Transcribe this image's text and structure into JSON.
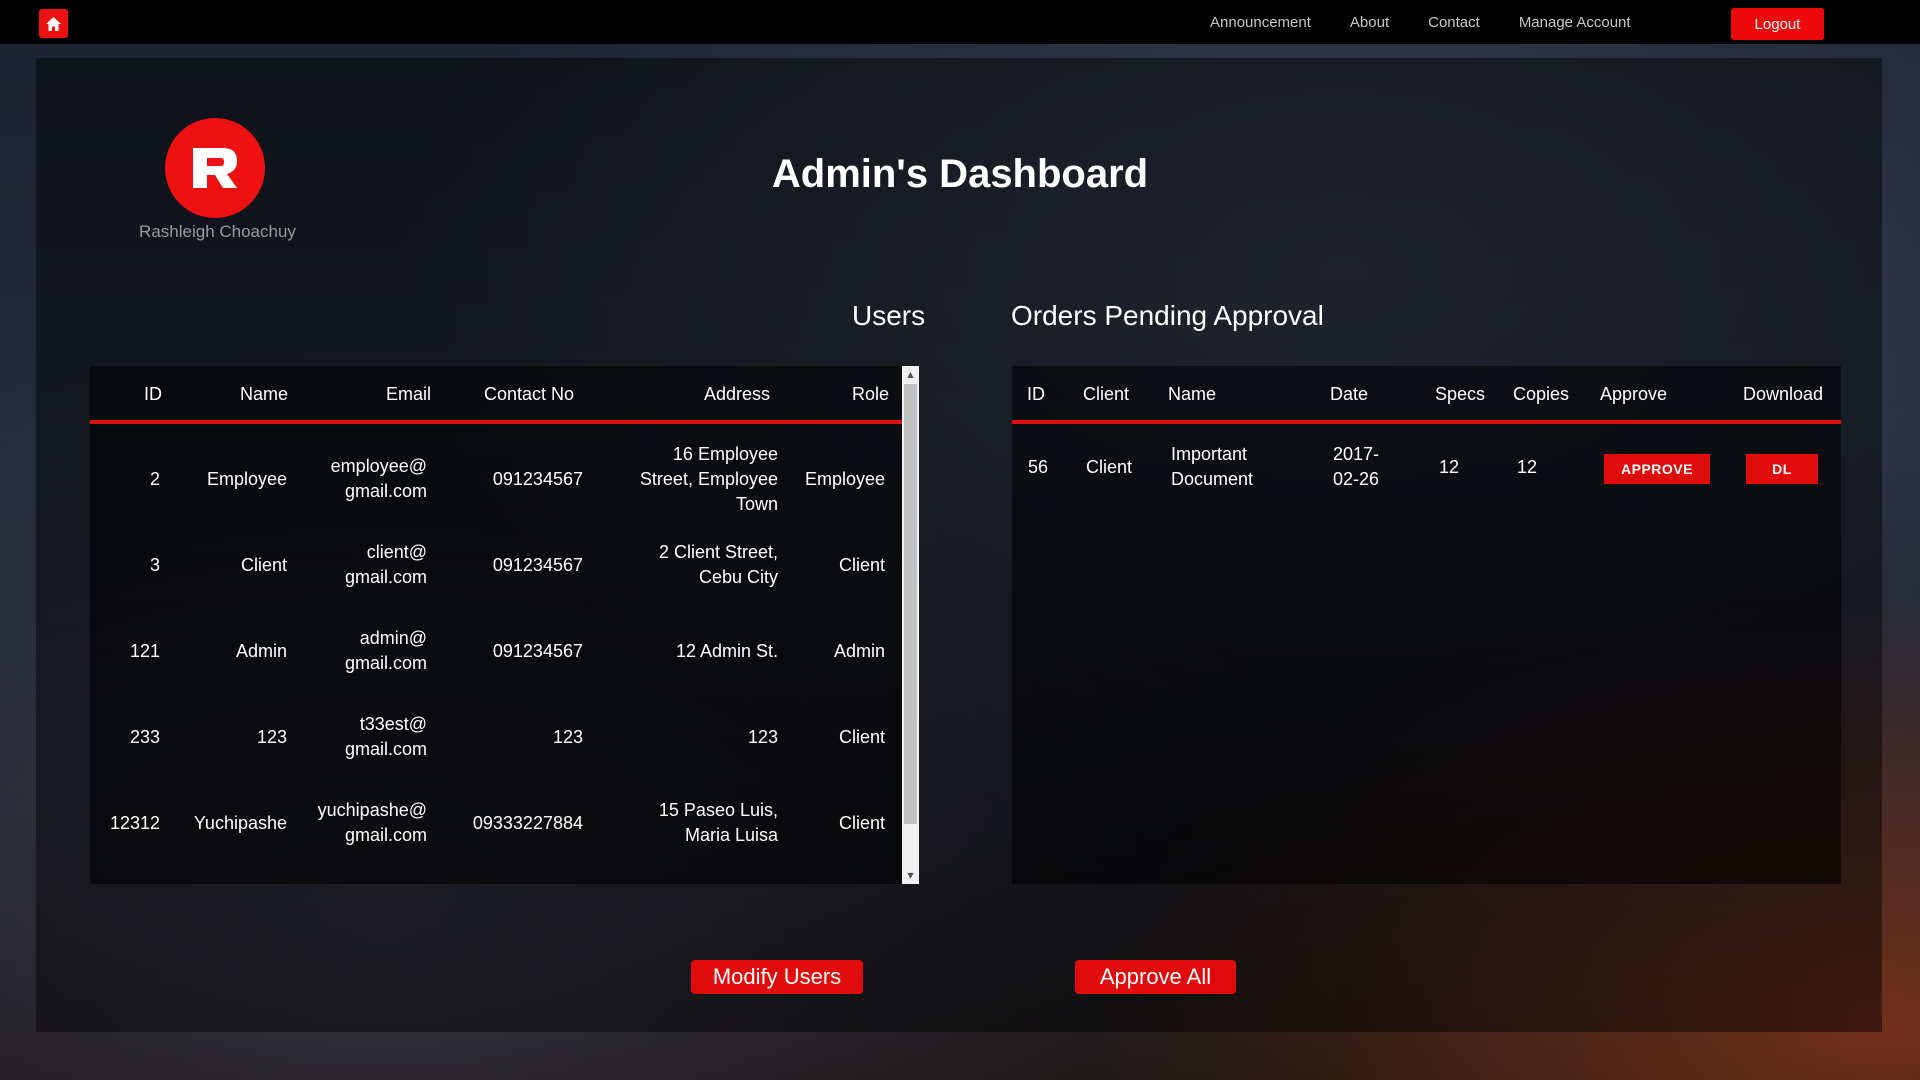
{
  "nav": {
    "links": [
      "Announcement",
      "About",
      "Contact",
      "Manage Account"
    ],
    "logout_label": "Logout",
    "home_icon": "home-icon"
  },
  "brand": {
    "name": "Rashleigh Choachuy",
    "logo_letter": "R"
  },
  "page_title": "Admin's Dashboard",
  "users": {
    "title": "Users",
    "headers": [
      "ID",
      "Name",
      "Email",
      "Contact No",
      "Address",
      "Role"
    ],
    "rows": [
      {
        "id": "2",
        "name": "Employee",
        "email": [
          "employee@",
          "gmail.com"
        ],
        "contact": "091234567",
        "address": [
          "16 Employee",
          "Street, Employee",
          "Town"
        ],
        "role": "Employee"
      },
      {
        "id": "3",
        "name": "Client",
        "email": [
          "client@",
          "gmail.com"
        ],
        "contact": "091234567",
        "address": [
          "2 Client Street,",
          "Cebu City"
        ],
        "role": "Client"
      },
      {
        "id": "121",
        "name": "Admin",
        "email": [
          "admin@",
          "gmail.com"
        ],
        "contact": "091234567",
        "address": [
          "12 Admin St."
        ],
        "role": "Admin"
      },
      {
        "id": "233",
        "name": "123",
        "email": [
          "t33est@",
          "gmail.com"
        ],
        "contact": "123",
        "address": [
          "123"
        ],
        "role": "Client"
      },
      {
        "id": "12312",
        "name": "Yuchipashe",
        "email": [
          "yuchipashe@",
          "gmail.com"
        ],
        "contact": "09333227884",
        "address": [
          "15 Paseo Luis,",
          "Maria Luisa"
        ],
        "role": "Client"
      }
    ],
    "button_label": "Modify Users"
  },
  "orders": {
    "title": "Orders Pending Approval",
    "headers": [
      "ID",
      "Client",
      "Name",
      "Date",
      "Specs",
      "Copies",
      "Approve",
      "Download"
    ],
    "rows": [
      {
        "id": "56",
        "client": "Client",
        "name": [
          "Important",
          "Document"
        ],
        "date": [
          "2017-",
          "02-26"
        ],
        "specs": "12",
        "copies": "12",
        "approve_label": "APPROVE",
        "download_label": "DL"
      }
    ],
    "button_label": "Approve All"
  },
  "colors": {
    "accent": "#ee1111",
    "nav_bg": "#000000"
  }
}
